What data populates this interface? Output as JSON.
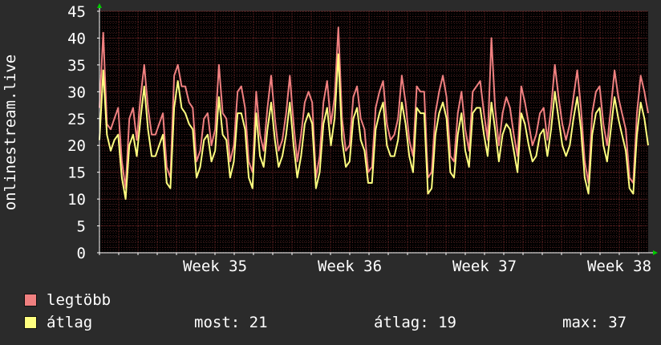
{
  "chart_data": {
    "type": "line",
    "ylabel": "onlinestream.live",
    "ylim": [
      0,
      45
    ],
    "yticks": [
      0,
      5,
      10,
      15,
      20,
      25,
      30,
      35,
      40,
      45
    ],
    "xlim": [
      0,
      28.5
    ],
    "x_ticks": [
      {
        "label": "Week 35",
        "x": 6
      },
      {
        "label": "Week 36",
        "x": 13
      },
      {
        "label": "Week 37",
        "x": 20
      },
      {
        "label": "Week 38",
        "x": 27
      }
    ],
    "grid": true,
    "legend_position": "bottom-left",
    "colors": {
      "background": "#2b2b2b",
      "plot_background": "#000000",
      "grid_minor": "#4a2020",
      "grid_major": "#7a2a2a",
      "axis": "#ffffff",
      "arrow": "#00cc00"
    },
    "series": [
      {
        "name": "legtöbb",
        "color": "#f08080",
        "values": [
          27,
          41,
          24,
          23,
          25,
          27,
          17,
          12,
          25,
          27,
          21,
          29,
          35,
          27,
          22,
          22,
          24,
          26,
          16,
          14,
          33,
          35,
          31,
          31,
          28,
          27,
          17,
          19,
          25,
          26,
          20,
          23,
          35,
          26,
          25,
          17,
          20,
          30,
          31,
          27,
          17,
          15,
          30,
          22,
          19,
          27,
          33,
          25,
          19,
          21,
          26,
          33,
          24,
          17,
          22,
          28,
          30,
          28,
          14,
          18,
          28,
          32,
          24,
          29,
          42,
          25,
          19,
          20,
          29,
          31,
          25,
          23,
          15,
          16,
          27,
          30,
          32,
          24,
          21,
          22,
          25,
          33,
          28,
          21,
          18,
          31,
          30,
          30,
          14,
          15,
          26,
          30,
          33,
          29,
          18,
          17,
          26,
          30,
          23,
          19,
          30,
          31,
          32,
          26,
          21,
          40,
          27,
          20,
          26,
          29,
          27,
          22,
          18,
          31,
          28,
          24,
          20,
          22,
          26,
          27,
          21,
          27,
          35,
          29,
          24,
          21,
          24,
          29,
          34,
          27,
          17,
          13,
          26,
          30,
          31,
          24,
          20,
          27,
          34,
          29,
          26,
          23,
          14,
          13,
          26,
          33,
          30,
          26
        ]
      },
      {
        "name": "átlag",
        "color": "#ffff80",
        "values": [
          21,
          34,
          22,
          19,
          21,
          22,
          14,
          10,
          20,
          22,
          18,
          25,
          31,
          23,
          18,
          18,
          20,
          22,
          13,
          12,
          27,
          32,
          27,
          26,
          24,
          23,
          14,
          16,
          21,
          22,
          17,
          19,
          29,
          22,
          21,
          14,
          17,
          26,
          26,
          23,
          14,
          12,
          26,
          18,
          16,
          23,
          28,
          21,
          16,
          18,
          22,
          28,
          20,
          14,
          18,
          24,
          26,
          24,
          12,
          15,
          24,
          27,
          20,
          25,
          37,
          21,
          16,
          17,
          25,
          27,
          21,
          19,
          13,
          13,
          23,
          26,
          28,
          20,
          18,
          18,
          21,
          28,
          24,
          18,
          15,
          27,
          26,
          26,
          11,
          12,
          22,
          26,
          28,
          25,
          15,
          14,
          22,
          26,
          19,
          16,
          26,
          27,
          27,
          22,
          18,
          28,
          23,
          17,
          22,
          24,
          23,
          19,
          15,
          26,
          24,
          20,
          17,
          18,
          22,
          23,
          18,
          23,
          30,
          25,
          20,
          18,
          20,
          25,
          29,
          23,
          14,
          11,
          22,
          26,
          27,
          20,
          17,
          23,
          29,
          25,
          22,
          19,
          12,
          11,
          22,
          28,
          25,
          20
        ]
      }
    ],
    "stats": [
      {
        "label": "most:",
        "value": 21
      },
      {
        "label": "átlag:",
        "value": 19
      },
      {
        "label": "max:",
        "value": 37
      }
    ]
  }
}
